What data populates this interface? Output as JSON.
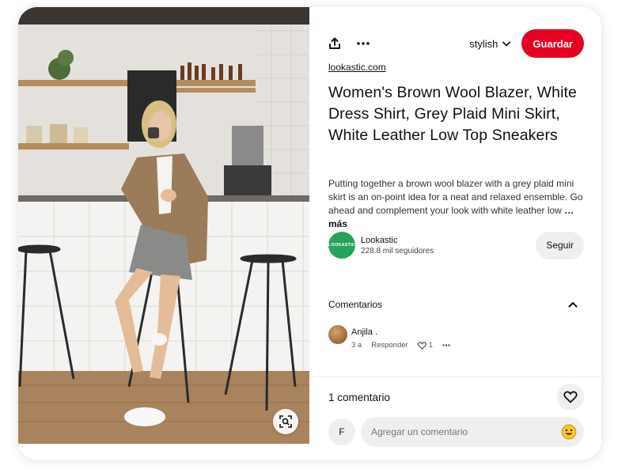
{
  "pin": {
    "source": "lookastic.com",
    "title": "Women's Brown Wool Blazer, White Dress Shirt, Grey Plaid Mini Skirt, White Leather Low Top Sneakers",
    "description": "Putting together a brown wool blazer with a grey plaid mini skirt is an on-point idea for a neat and relaxed ensemble. Go ahead and complement your look with white leather low",
    "more_label": "… más"
  },
  "toolbar": {
    "board_name": "stylish",
    "save_label": "Guardar"
  },
  "creator": {
    "avatar_text": "LOOKASTIC",
    "name": "Lookastic",
    "followers": "228.8 mil seguidores",
    "follow_label": "Seguir"
  },
  "comments": {
    "title": "Comentarios",
    "items": [
      {
        "author": "Anjila .",
        "age": "3 a",
        "reply_label": "Responder",
        "likes": "1"
      }
    ],
    "count_label": "1 comentario",
    "self_initial": "F",
    "input_placeholder": "Agregar un comentario"
  },
  "colors": {
    "save": "#e60023",
    "creator_avatar": "#27a35a",
    "button_bg": "#efefef"
  },
  "icons": [
    "share-icon",
    "more-icon",
    "chevron-down-icon",
    "chevron-up-icon",
    "heart-icon",
    "emoji-icon",
    "visual-search-icon"
  ]
}
